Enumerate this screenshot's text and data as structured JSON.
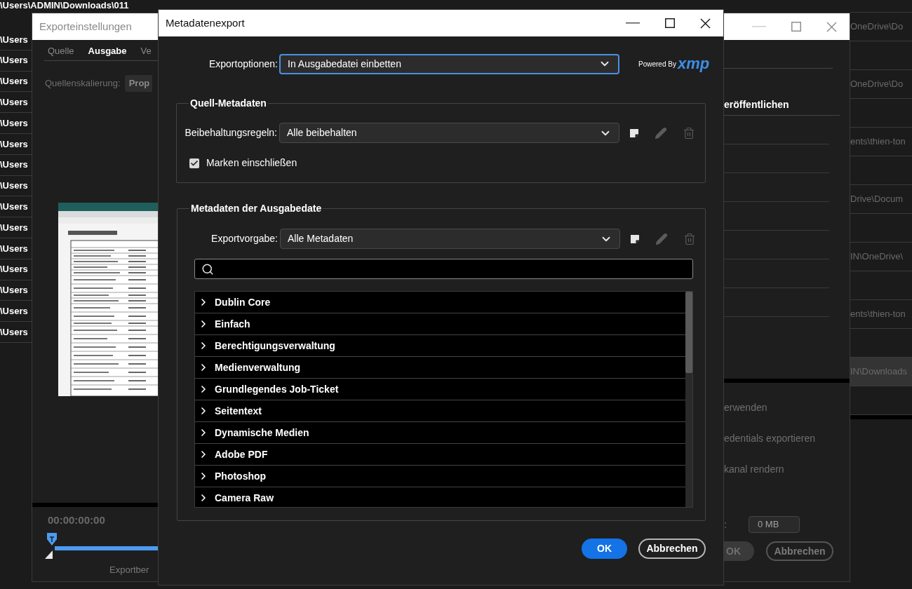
{
  "desktop": {
    "top_path": "\\Users\\ADMIN\\Downloads\\011",
    "left_paths": [
      "\\Users",
      "\\Users",
      "\\Users",
      "\\Users",
      "\\Users",
      "\\Users",
      "\\Users",
      "\\Users",
      "\\Users",
      "\\Users",
      "\\Users",
      "\\Users",
      "\\Users",
      "\\Users",
      "\\Users"
    ],
    "right_paths": [
      {
        "text": "OneDrive\\Do",
        "selected": false
      },
      {
        "text": "OneDrive\\Do",
        "selected": false
      },
      {
        "text": "ents\\thien-ton",
        "selected": false
      },
      {
        "text": "Drive\\Docum",
        "selected": false
      },
      {
        "text": "IN\\OneDrive\\",
        "selected": false
      },
      {
        "text": "ents\\thien-ton",
        "selected": false
      },
      {
        "text": "IN\\Downloads",
        "selected": true
      }
    ]
  },
  "export_window": {
    "title": "Exporteinstellungen",
    "tabs": [
      {
        "label": "Quelle",
        "selected": false
      },
      {
        "label": "Ausgabe",
        "selected": true
      },
      {
        "label": "Ve",
        "selected": false
      }
    ],
    "scaling": {
      "label": "Quellenskalierung:",
      "value": "Prop"
    },
    "timecode": "00:00:00:00",
    "playhead": {
      "level": 0
    },
    "range_label": "Exportber",
    "publish_heading": "eröffentlichen",
    "options": [
      "erwenden",
      "edentials exportieren",
      "kanal rendern"
    ],
    "size": {
      "label": ":",
      "value": "0 MB"
    },
    "buttons": [
      {
        "label": "OK",
        "kind": "primary"
      },
      {
        "label": "Abbrechen",
        "kind": "secondary"
      }
    ]
  },
  "dialog": {
    "title": "Metadatenexport",
    "export_options": {
      "label": "Exportoptionen:",
      "value": "In Ausgabedatei einbetten",
      "focused": true
    },
    "powered_by": {
      "prefix": "Powered By",
      "brand": "xmp"
    },
    "source_group": {
      "title": "Quell-Metadaten",
      "rule": {
        "label": "Beibehaltungsregeln:",
        "value": "Alle beibehalten"
      },
      "actions": [
        {
          "kind": "new",
          "disabled": false
        },
        {
          "kind": "edit",
          "disabled": true
        },
        {
          "kind": "delete",
          "disabled": true
        }
      ],
      "include_markers": {
        "label": "Marken einschließen",
        "checked": true
      }
    },
    "output_group": {
      "title": "Metadaten der Ausgabedate",
      "preset": {
        "label": "Exportvorgabe:",
        "value": "Alle Metadaten"
      },
      "actions": [
        {
          "kind": "new",
          "disabled": false
        },
        {
          "kind": "edit",
          "disabled": true
        },
        {
          "kind": "delete",
          "disabled": true
        }
      ],
      "categories": [
        {
          "label": "Dublin Core",
          "expanded": false
        },
        {
          "label": "Einfach",
          "expanded": false
        },
        {
          "label": "Berechtigungsverwaltung",
          "expanded": false
        },
        {
          "label": "Medienverwaltung",
          "expanded": false
        },
        {
          "label": "Grundlegendes Job-Ticket",
          "expanded": false
        },
        {
          "label": "Seitentext",
          "expanded": false
        },
        {
          "label": "Dynamische Medien",
          "expanded": false
        },
        {
          "label": "Adobe PDF",
          "expanded": false
        },
        {
          "label": "Photoshop",
          "expanded": false
        },
        {
          "label": "Camera Raw",
          "expanded": false
        }
      ]
    },
    "buttons": [
      {
        "label": "OK",
        "kind": "primary"
      },
      {
        "label": "Abbrechen",
        "kind": "secondary"
      }
    ]
  }
}
